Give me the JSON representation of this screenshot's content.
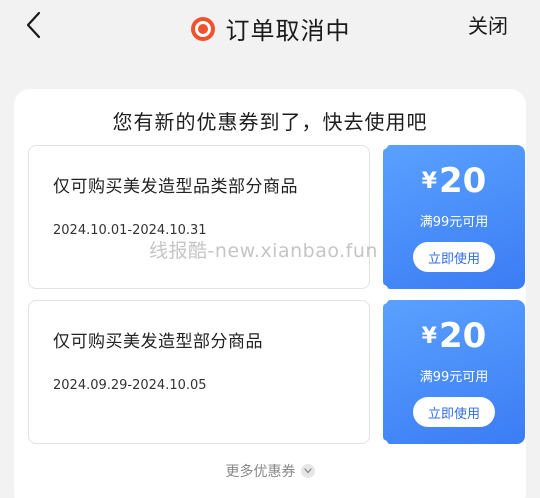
{
  "header": {
    "title": "订单取消中",
    "close_label": "关闭",
    "status_icon_color": "#f0522d"
  },
  "card": {
    "heading": "您有新的优惠券到了，快去使用吧"
  },
  "coupons": [
    {
      "description": "仅可购买美发造型品类部分商品",
      "date_range": "2024.10.01-2024.10.31",
      "currency_symbol": "¥",
      "amount": "20",
      "condition": "满99元可用",
      "button_label": "立即使用"
    },
    {
      "description": "仅可购买美发造型部分商品",
      "date_range": "2024.09.29-2024.10.05",
      "currency_symbol": "¥",
      "amount": "20",
      "condition": "满99元可用",
      "button_label": "立即使用"
    }
  ],
  "watermark": "线报酷-new.xianbao.fun",
  "more_label": "更多优惠券",
  "colors": {
    "coupon_gradient_start": "#5aa1ff",
    "coupon_gradient_end": "#3b7cf4",
    "button_text": "#2f6de6"
  }
}
